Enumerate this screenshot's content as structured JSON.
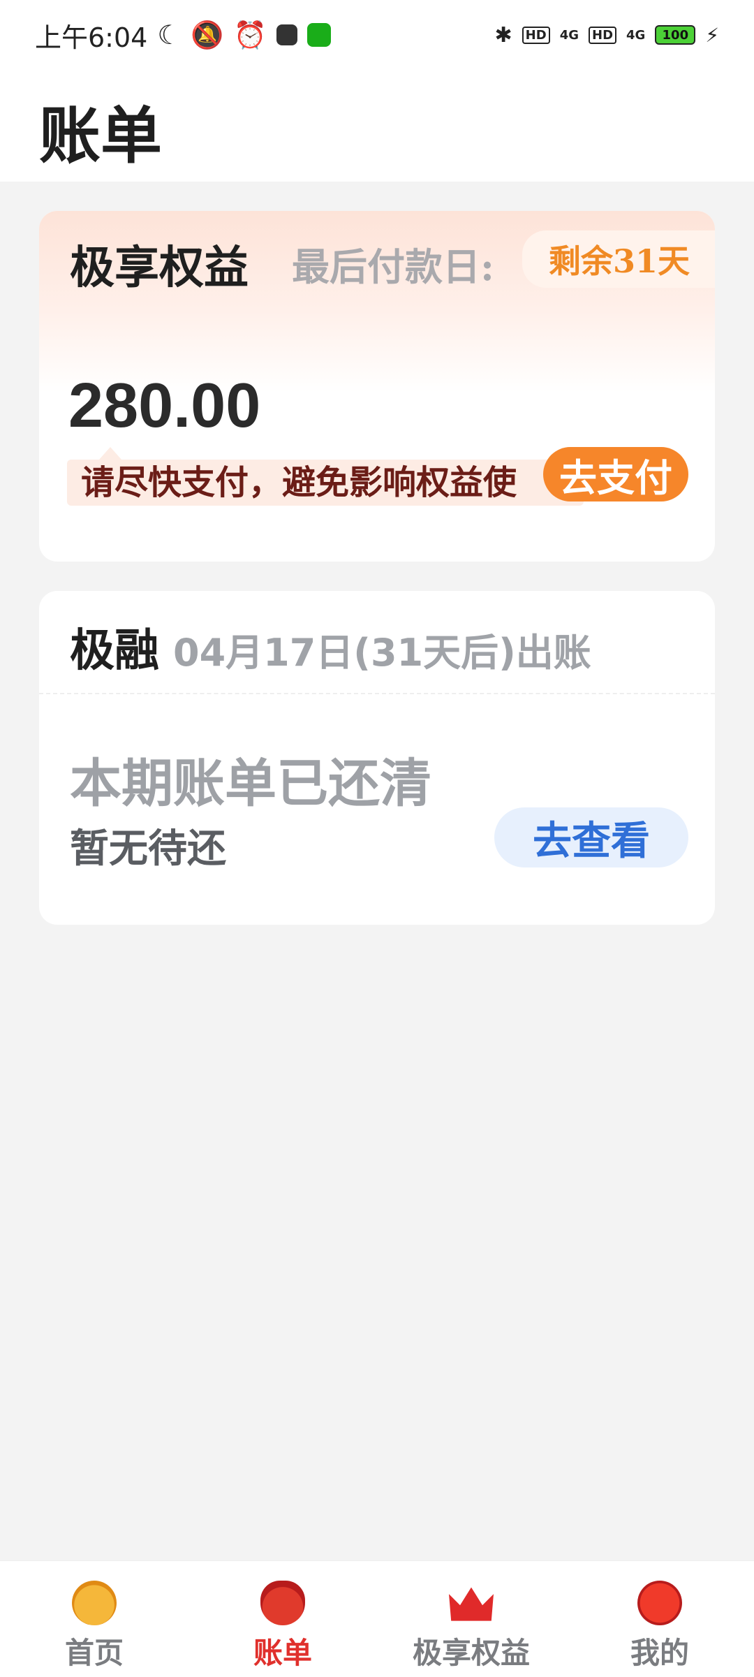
{
  "statusbar": {
    "time": "上午6:04",
    "hd1": "HD",
    "sig1": "4G",
    "hd2": "HD",
    "sig2": "4G",
    "battery": "100"
  },
  "header": {
    "title": "账单"
  },
  "card1": {
    "title": "极享权益",
    "last_pay_label": "最后付款日:",
    "remain": "剩余31天",
    "amount": "280.00",
    "warn": "请尽快支付，避免影响权益使",
    "pay_button": "去支付"
  },
  "card2": {
    "title": "极融",
    "bill_date": "04月17日(31天后)出账",
    "cleared": "本期账单已还清",
    "no_due": "暂无待还",
    "view_button": "去查看"
  },
  "nav": {
    "items": [
      {
        "label": "首页",
        "icon": "tiger-icon"
      },
      {
        "label": "账单",
        "icon": "red-bag-icon"
      },
      {
        "label": "极享权益",
        "icon": "crown-icon"
      },
      {
        "label": "我的",
        "icon": "lantern-icon"
      }
    ],
    "active_color": "#e0302c"
  }
}
